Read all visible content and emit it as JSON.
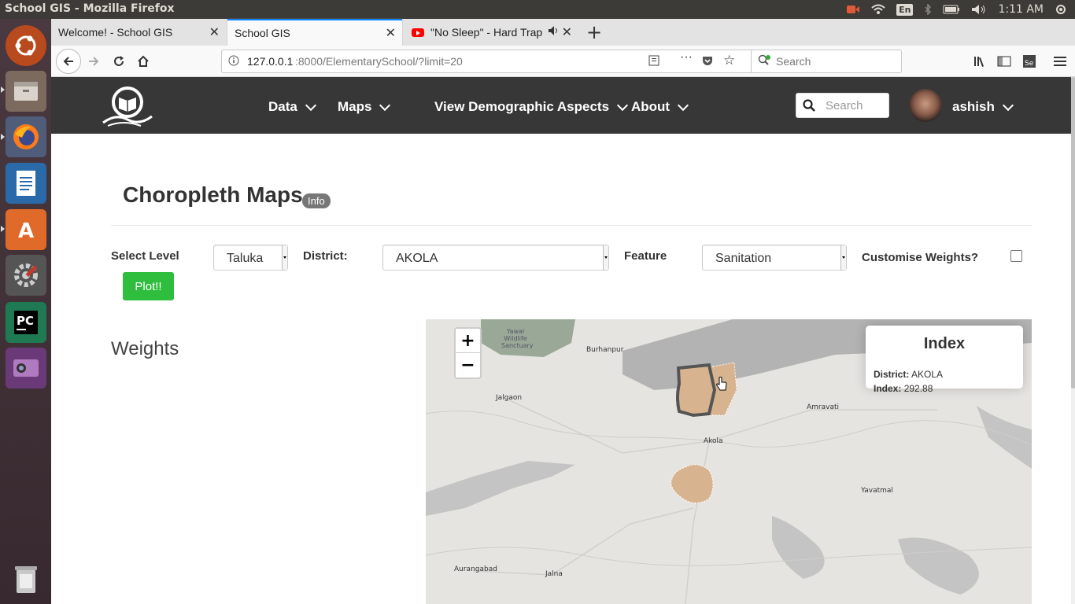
{
  "window": {
    "title": "School GIS - Mozilla Firefox"
  },
  "tray": {
    "lang": "En",
    "time": "1:11 AM"
  },
  "launcher": {
    "items": [
      "ubuntu-dash",
      "files",
      "firefox",
      "libreoffice-writer",
      "software-center",
      "system-settings",
      "pycharm",
      "screen-recorder",
      "trash"
    ]
  },
  "browser": {
    "tabs": [
      {
        "label": "Welcome! - School GIS",
        "active": false
      },
      {
        "label": "School GIS",
        "active": true
      },
      {
        "label": "\"No Sleep\" - Hard Trap",
        "active": false
      }
    ],
    "url_host": "127.0.0.1",
    "url_path": ":8000/ElementarySchool/?limit=20",
    "search_placeholder": "Search"
  },
  "site": {
    "nav": [
      {
        "label": "Data"
      },
      {
        "label": "Maps"
      },
      {
        "label": "View Demographic Aspects"
      },
      {
        "label": "About"
      }
    ],
    "search_placeholder": "Search",
    "user": "ashish"
  },
  "content": {
    "title": "Choropleth Maps",
    "info_badge": "Info",
    "select_level_label": "Select Level",
    "level_value": "Taluka",
    "district_label": "District:",
    "district_value": "AKOLA",
    "feature_label": "Feature",
    "feature_value": "Sanitation",
    "customise_label": "Customise Weights?",
    "plot_button": "Plot!!",
    "weights_heading": "Weights"
  },
  "map": {
    "zoom_in": "+",
    "zoom_out": "−",
    "info_title": "Index",
    "district_key": "District:",
    "district_val": "AKOLA",
    "index_key": "Index:",
    "index_val": "292.88",
    "places": [
      "Yawal Wildlife Sanctuary",
      "Burhanpur",
      "Jalgaon",
      "Amravati",
      "Akola",
      "Yavatmal",
      "Aurangabad",
      "Jalna"
    ],
    "colors": {
      "polygon": "#d7b48f",
      "highlight_border": "#555555"
    }
  }
}
